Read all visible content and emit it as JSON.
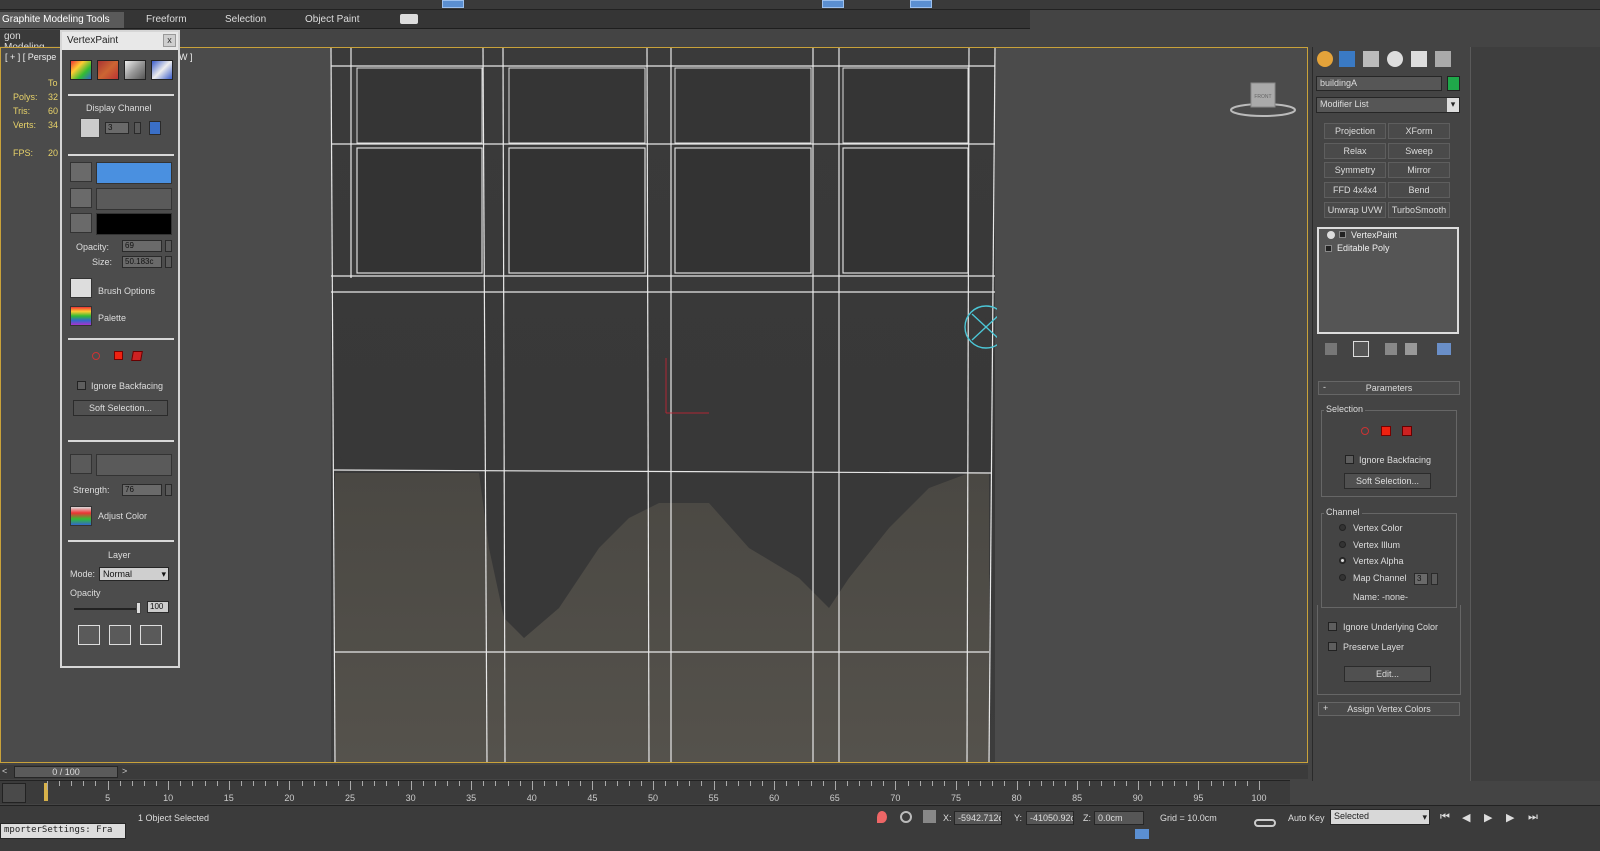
{
  "ribbon": {
    "tabs": [
      "Graphite Modeling Tools",
      "Freeform",
      "Selection",
      "Object Paint"
    ],
    "row2_label": "gon Modeling"
  },
  "viewport": {
    "label_left": "[ + ] [ Perspe",
    "label_right": "W ]",
    "stats": {
      "header": "To",
      "polys_label": "Polys:",
      "polys_value": "32",
      "tris_label": "Tris:",
      "tris_value": "60",
      "verts_label": "Verts:",
      "verts_value": "34",
      "fps_label": "FPS:",
      "fps_value": "20"
    },
    "viewcube_label": "FRONT"
  },
  "vertex_paint": {
    "title": "VertexPaint",
    "close": "x",
    "display_channel_label": "Display Channel",
    "display_channel_value": "3",
    "opacity_label": "Opacity:",
    "opacity_value": "69",
    "size_label": "Size:",
    "size_value": "50.183c",
    "brush_options_label": "Brush Options",
    "palette_label": "Palette",
    "ignore_backfacing_label": "Ignore Backfacing",
    "soft_selection_label": "Soft Selection...",
    "strength_label": "Strength:",
    "strength_value": "76",
    "adjust_color_label": "Adjust Color",
    "layer_title": "Layer",
    "mode_label": "Mode:",
    "mode_value": "Normal",
    "layer_opacity_label": "Opacity",
    "layer_opacity_value": "100",
    "paint_color": "#4a90e0",
    "erase_color": "#000000"
  },
  "command_panel": {
    "object_name": "buildingA",
    "object_color": "#1fa84a",
    "modifier_list_label": "Modifier List",
    "modifier_buttons": [
      "Projection",
      "XForm",
      "Relax",
      "Sweep",
      "Symmetry",
      "Mirror",
      "FFD 4x4x4",
      "Bend",
      "Unwrap UVW",
      "TurboSmooth"
    ],
    "stack": [
      "VertexPaint",
      "Editable Poly"
    ],
    "parameters_title": "Parameters",
    "parameters_toggle": "-",
    "selection_title": "Selection",
    "ignore_backfacing_label": "Ignore Backfacing",
    "soft_selection_label": "Soft Selection...",
    "channel_title": "Channel",
    "channel_options": [
      "Vertex Color",
      "Vertex Illum",
      "Vertex Alpha",
      "Map Channel"
    ],
    "channel_selected": "Vertex Alpha",
    "map_channel_value": "3",
    "name_label": "Name: -none-",
    "ignore_underlying_label": "Ignore Underlying Color",
    "preserve_layer_label": "Preserve Layer",
    "edit_label": "Edit...",
    "assign_toggle": "+",
    "assign_label": "Assign Vertex Colors"
  },
  "timeline": {
    "slider_label": "0 / 100",
    "prev": "<",
    "next": ">",
    "ticks": [
      0,
      5,
      10,
      15,
      20,
      25,
      30,
      35,
      40,
      45,
      50,
      55,
      60,
      65,
      70,
      75,
      80,
      85,
      90,
      95,
      100
    ]
  },
  "status": {
    "script_text": "mporterSettings: Fra",
    "selected_text": "1 Object Selected",
    "x_label": "X:",
    "x_value": "-5942.712c",
    "y_label": "Y:",
    "y_value": "-41050.92c",
    "z_label": "Z:",
    "z_value": "0.0cm",
    "grid_text": "Grid = 10.0cm",
    "auto_key_label": "Auto Key",
    "key_mode_value": "Selected"
  }
}
